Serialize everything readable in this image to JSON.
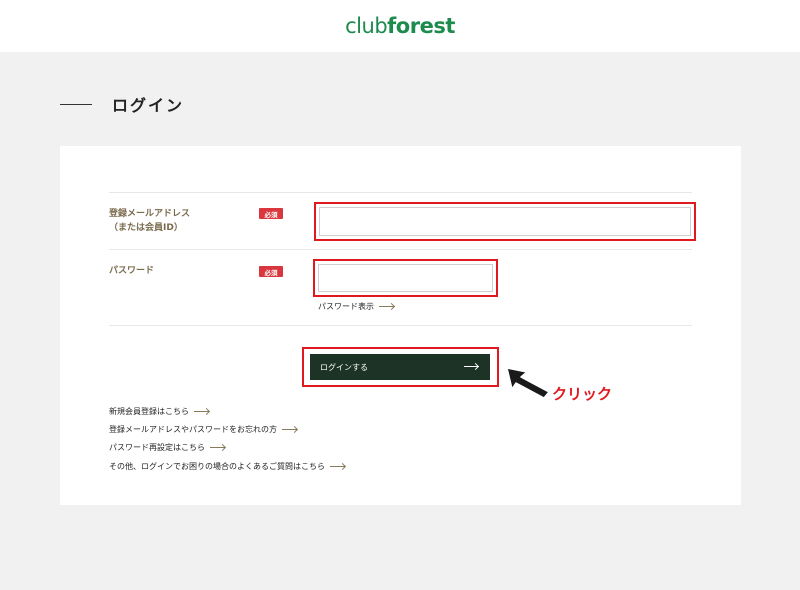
{
  "header": {
    "logo_part1": "club",
    "logo_part2": "forest"
  },
  "page": {
    "title": "ログイン"
  },
  "form": {
    "email": {
      "label_line1": "登録メールアドレス",
      "label_line2": "（または会員ID）",
      "required_badge": "必須",
      "value": "",
      "placeholder": ""
    },
    "password": {
      "label": "パスワード",
      "required_badge": "必須",
      "value": "",
      "placeholder": "",
      "show_toggle_label": "パスワード表示"
    },
    "submit_label": "ログインする"
  },
  "links": [
    {
      "label": "新規会員登録はこちら"
    },
    {
      "label": "登録メールアドレスやパスワードをお忘れの方"
    },
    {
      "label": "パスワード再設定はこちら"
    },
    {
      "label": "その他、ログインでお困りの場合のよくあるご質問はこちら"
    }
  ],
  "annotation": {
    "text": "クリック"
  },
  "colors": {
    "brand_green": "#1d8a4e",
    "button_dark_green": "#1c3326",
    "required_red": "#d9363e",
    "annotation_red": "#e0191f",
    "label_brown": "#7a6a4c"
  }
}
